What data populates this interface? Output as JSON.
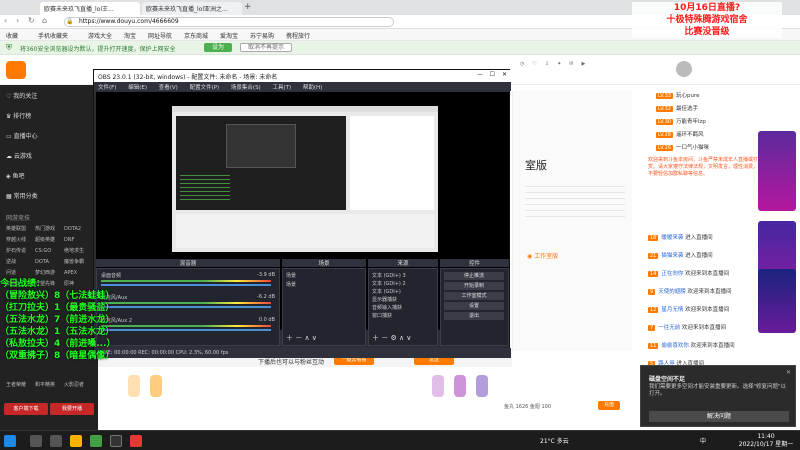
{
  "browser": {
    "tabs": [
      {
        "label": "欧赛未来玖飞直播_lol王...",
        "active": true
      },
      {
        "label": "欧赛未来玖飞直播_lol亚洲之..."
      }
    ],
    "url": "https://www.douyu.com/4666609",
    "bookmarks": [
      "收藏",
      "手机收藏夹",
      "游戏大全",
      "淘宝",
      "网址导航",
      "京东商城",
      "爱淘宝",
      "苏宁易购",
      "携程旅行"
    ],
    "notice": "将360安全浏览器设为默认，提升打开速度，保护上网安全",
    "notice_btn": "设为",
    "notice_btn2": "取消不再提示"
  },
  "overlay": {
    "red_line1": "10月16日直播?",
    "red_line2": "十极特殊腾游戏宿舍",
    "red_line3": "比赛没晋级",
    "green_title": "今日战绩：",
    "green_lines": [
      "（冒险敖兴）8（七法蛙蛙）",
      "（扛刀拉夫）1（最贵骚盐）",
      "（五法水龙）7（前进水龙）",
      "（五法水龙）1（五法水龙）",
      "（私敖拉夫）4（前进嗓...）",
      "（双重拂子）8（暗星偶像）"
    ]
  },
  "sidebar": {
    "items": [
      "我的关注",
      "排行榜",
      "直播中心",
      "云游戏",
      "鱼吧",
      "常用分类"
    ],
    "section": "网游竞技",
    "grid": [
      "英雄联盟",
      "热门游戏",
      "DOTA2",
      "穿越火线",
      "超级英雄",
      "DNF",
      "炉石传说",
      "CS:GO",
      "绝地求生",
      "逆战",
      "DOTA",
      "魔兽争霸",
      "问道",
      "梦幻西游",
      "APEX",
      "剑网3",
      "守望先锋",
      "原神"
    ],
    "extra": [
      "王者荣耀",
      "和平精英",
      "火影忍者"
    ],
    "bottom_btns": [
      "客户端下载",
      "我要开播"
    ]
  },
  "obs": {
    "title": "OBS 23.0.1 (32-bit, windows) - 配置文件: 未命名 - 场景: 未命名",
    "menu": [
      "文件(F)",
      "编辑(E)",
      "查看(V)",
      "配置文件(P)",
      "场景集合(S)",
      "工具(T)",
      "帮助(H)"
    ],
    "panels": {
      "mixer": "混音器",
      "scenes": "场景",
      "sources": "来源",
      "controls": "控件"
    },
    "mixer_tracks": [
      {
        "label": "桌面音频",
        "db": "-3.9 dB"
      },
      {
        "label": "麦克风/Aux",
        "db": "-6.2 dB"
      },
      {
        "label": "麦克风/Aux 2",
        "db": "0.0 dB"
      }
    ],
    "scenes_list": [
      "场景",
      "场景"
    ],
    "sources_list": [
      "文本 (GDI+) 3",
      "文本 (GDI+) 2",
      "文本 (GDI+)",
      "显示器捕获",
      "音频输入捕获",
      "窗口捕获"
    ],
    "controls_btns": [
      "停止推流",
      "开始录制",
      "工作室模式",
      "设置",
      "退出"
    ],
    "status": "LIVE: 00:00:00   REC: 00:00:00   CPU: 2.3%, 60.00 fps"
  },
  "web": {
    "version_text": "室版",
    "live_note": "下播后也可以与粉丝互动",
    "live_note_btn": "一键去看看",
    "danmu_btn": "发送",
    "bottom_stat": "鱼丸 1626  鱼翅 100",
    "bottom_btn": "充值"
  },
  "chat": {
    "ranks": [
      {
        "lv": "LV.33",
        "name": "玩心pure"
      },
      {
        "lv": "LV.32",
        "name": "最佳选手"
      },
      {
        "lv": "LV.30",
        "name": "万能青年lzp"
      },
      {
        "lv": "LV.28",
        "name": "遥环不羁风"
      },
      {
        "lv": "LV.26",
        "name": "一口气小猫咪"
      }
    ],
    "sys_msg": "欢迎来到斗鱼本房间，斗鱼严禁未成年人直播或打赏。请大家遵守法律法规，文明发言，理性消费，不要轻信加群私聊等信息。",
    "lines": [
      {
        "lv": "18",
        "user": "暖暖来袭",
        "text": "进入直播间"
      },
      {
        "lv": "21",
        "user": "猫猫来袭",
        "text": "进入直播间"
      },
      {
        "lv": "14",
        "user": "正在向你",
        "text": "欢迎来到本直播间"
      },
      {
        "lv": "9",
        "user": "天使的翅膀",
        "text": "欢迎来到本直播间"
      },
      {
        "lv": "12",
        "user": "星月无情",
        "text": "欢迎来到本直播间"
      },
      {
        "lv": "7",
        "user": "一往无前",
        "text": "欢迎来到本直播间"
      },
      {
        "lv": "11",
        "user": "偷偷喜欢你",
        "text": "欢迎来到本直播间"
      },
      {
        "lv": "5",
        "user": "路人甲",
        "text": "进入直播间"
      }
    ]
  },
  "notification": {
    "title": "磁盘空间不足",
    "body": "我们需要更多空间才能安装重要更新。选择\"修复问题\"以打开。",
    "button": "解决问题"
  },
  "taskbar": {
    "temp": "21°C 多云",
    "lang": "中",
    "time": "11:40",
    "date": "2022/10/17 星期一"
  },
  "colors": {
    "douyu_orange": "#ff7a00",
    "obs_bg": "#2b2e38",
    "green_overlay": "#23ff23",
    "red_overlay": "#ff1a1a"
  }
}
